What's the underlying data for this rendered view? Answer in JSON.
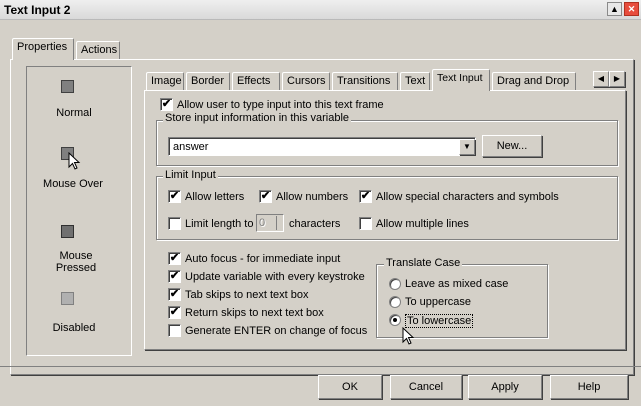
{
  "window": {
    "title": "Text Input 2"
  },
  "left_tabs": [
    {
      "label": "Properties"
    },
    {
      "label": "Actions"
    }
  ],
  "states": [
    {
      "label": "Normal"
    },
    {
      "label": "Mouse Over"
    },
    {
      "label": "Mouse Pressed"
    },
    {
      "label": "Disabled"
    }
  ],
  "tabs": [
    {
      "label": "Image"
    },
    {
      "label": "Border"
    },
    {
      "label": "Effects"
    },
    {
      "label": "Cursors"
    },
    {
      "label": "Transitions"
    },
    {
      "label": "Text"
    },
    {
      "label": "Text Input"
    },
    {
      "label": "Drag and Drop"
    }
  ],
  "text_input": {
    "allow_user_label": "Allow user to type input into this text frame",
    "store_group_label": "Store input information in this variable",
    "variable_value": "answer",
    "new_button": "New...",
    "limit_group_label": "Limit Input",
    "allow_letters": "Allow letters",
    "allow_numbers": "Allow numbers",
    "allow_special": "Allow special characters and symbols",
    "limit_length_label": "Limit length to",
    "limit_length_value": "0",
    "characters_label": "characters",
    "allow_multiple": "Allow multiple lines",
    "auto_focus": "Auto focus - for immediate input",
    "update_variable": "Update variable with every keystroke",
    "tab_skips": "Tab skips to next text box",
    "return_skips": "Return skips to next text box",
    "generate_enter": "Generate ENTER on change of focus",
    "translate_group_label": "Translate Case",
    "case_mixed": "Leave as mixed case",
    "case_upper": "To uppercase",
    "case_lower": "To lowercase"
  },
  "footer": {
    "ok": "OK",
    "cancel": "Cancel",
    "apply": "Apply",
    "help": "Help"
  },
  "icons": {
    "checked": "✔",
    "minimize": "▲",
    "close": "✕",
    "dropdown": "▼",
    "scroll_left": "◀",
    "scroll_right": "▶"
  }
}
